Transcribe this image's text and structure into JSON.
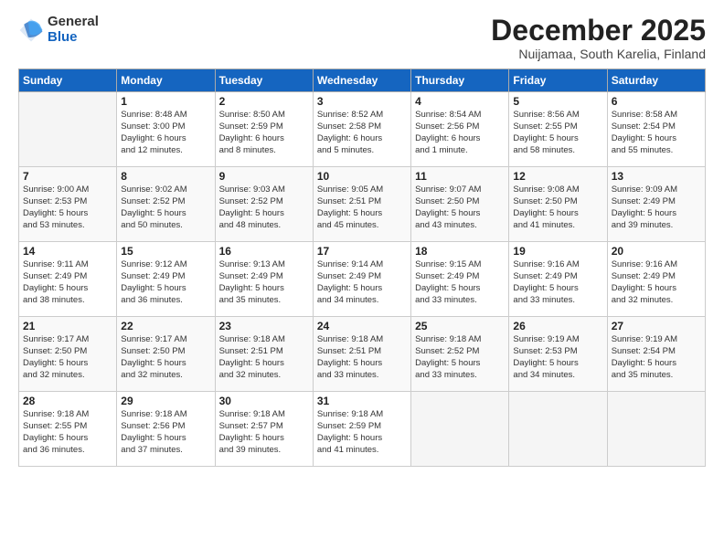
{
  "logo": {
    "general": "General",
    "blue": "Blue"
  },
  "title": "December 2025",
  "location": "Nuijamaa, South Karelia, Finland",
  "days_of_week": [
    "Sunday",
    "Monday",
    "Tuesday",
    "Wednesday",
    "Thursday",
    "Friday",
    "Saturday"
  ],
  "weeks": [
    [
      {
        "day": "",
        "info": ""
      },
      {
        "day": "1",
        "info": "Sunrise: 8:48 AM\nSunset: 3:00 PM\nDaylight: 6 hours\nand 12 minutes."
      },
      {
        "day": "2",
        "info": "Sunrise: 8:50 AM\nSunset: 2:59 PM\nDaylight: 6 hours\nand 8 minutes."
      },
      {
        "day": "3",
        "info": "Sunrise: 8:52 AM\nSunset: 2:58 PM\nDaylight: 6 hours\nand 5 minutes."
      },
      {
        "day": "4",
        "info": "Sunrise: 8:54 AM\nSunset: 2:56 PM\nDaylight: 6 hours\nand 1 minute."
      },
      {
        "day": "5",
        "info": "Sunrise: 8:56 AM\nSunset: 2:55 PM\nDaylight: 5 hours\nand 58 minutes."
      },
      {
        "day": "6",
        "info": "Sunrise: 8:58 AM\nSunset: 2:54 PM\nDaylight: 5 hours\nand 55 minutes."
      }
    ],
    [
      {
        "day": "7",
        "info": "Sunrise: 9:00 AM\nSunset: 2:53 PM\nDaylight: 5 hours\nand 53 minutes."
      },
      {
        "day": "8",
        "info": "Sunrise: 9:02 AM\nSunset: 2:52 PM\nDaylight: 5 hours\nand 50 minutes."
      },
      {
        "day": "9",
        "info": "Sunrise: 9:03 AM\nSunset: 2:52 PM\nDaylight: 5 hours\nand 48 minutes."
      },
      {
        "day": "10",
        "info": "Sunrise: 9:05 AM\nSunset: 2:51 PM\nDaylight: 5 hours\nand 45 minutes."
      },
      {
        "day": "11",
        "info": "Sunrise: 9:07 AM\nSunset: 2:50 PM\nDaylight: 5 hours\nand 43 minutes."
      },
      {
        "day": "12",
        "info": "Sunrise: 9:08 AM\nSunset: 2:50 PM\nDaylight: 5 hours\nand 41 minutes."
      },
      {
        "day": "13",
        "info": "Sunrise: 9:09 AM\nSunset: 2:49 PM\nDaylight: 5 hours\nand 39 minutes."
      }
    ],
    [
      {
        "day": "14",
        "info": "Sunrise: 9:11 AM\nSunset: 2:49 PM\nDaylight: 5 hours\nand 38 minutes."
      },
      {
        "day": "15",
        "info": "Sunrise: 9:12 AM\nSunset: 2:49 PM\nDaylight: 5 hours\nand 36 minutes."
      },
      {
        "day": "16",
        "info": "Sunrise: 9:13 AM\nSunset: 2:49 PM\nDaylight: 5 hours\nand 35 minutes."
      },
      {
        "day": "17",
        "info": "Sunrise: 9:14 AM\nSunset: 2:49 PM\nDaylight: 5 hours\nand 34 minutes."
      },
      {
        "day": "18",
        "info": "Sunrise: 9:15 AM\nSunset: 2:49 PM\nDaylight: 5 hours\nand 33 minutes."
      },
      {
        "day": "19",
        "info": "Sunrise: 9:16 AM\nSunset: 2:49 PM\nDaylight: 5 hours\nand 33 minutes."
      },
      {
        "day": "20",
        "info": "Sunrise: 9:16 AM\nSunset: 2:49 PM\nDaylight: 5 hours\nand 32 minutes."
      }
    ],
    [
      {
        "day": "21",
        "info": "Sunrise: 9:17 AM\nSunset: 2:50 PM\nDaylight: 5 hours\nand 32 minutes."
      },
      {
        "day": "22",
        "info": "Sunrise: 9:17 AM\nSunset: 2:50 PM\nDaylight: 5 hours\nand 32 minutes."
      },
      {
        "day": "23",
        "info": "Sunrise: 9:18 AM\nSunset: 2:51 PM\nDaylight: 5 hours\nand 32 minutes."
      },
      {
        "day": "24",
        "info": "Sunrise: 9:18 AM\nSunset: 2:51 PM\nDaylight: 5 hours\nand 33 minutes."
      },
      {
        "day": "25",
        "info": "Sunrise: 9:18 AM\nSunset: 2:52 PM\nDaylight: 5 hours\nand 33 minutes."
      },
      {
        "day": "26",
        "info": "Sunrise: 9:19 AM\nSunset: 2:53 PM\nDaylight: 5 hours\nand 34 minutes."
      },
      {
        "day": "27",
        "info": "Sunrise: 9:19 AM\nSunset: 2:54 PM\nDaylight: 5 hours\nand 35 minutes."
      }
    ],
    [
      {
        "day": "28",
        "info": "Sunrise: 9:18 AM\nSunset: 2:55 PM\nDaylight: 5 hours\nand 36 minutes."
      },
      {
        "day": "29",
        "info": "Sunrise: 9:18 AM\nSunset: 2:56 PM\nDaylight: 5 hours\nand 37 minutes."
      },
      {
        "day": "30",
        "info": "Sunrise: 9:18 AM\nSunset: 2:57 PM\nDaylight: 5 hours\nand 39 minutes."
      },
      {
        "day": "31",
        "info": "Sunrise: 9:18 AM\nSunset: 2:59 PM\nDaylight: 5 hours\nand 41 minutes."
      },
      {
        "day": "",
        "info": ""
      },
      {
        "day": "",
        "info": ""
      },
      {
        "day": "",
        "info": ""
      }
    ]
  ]
}
